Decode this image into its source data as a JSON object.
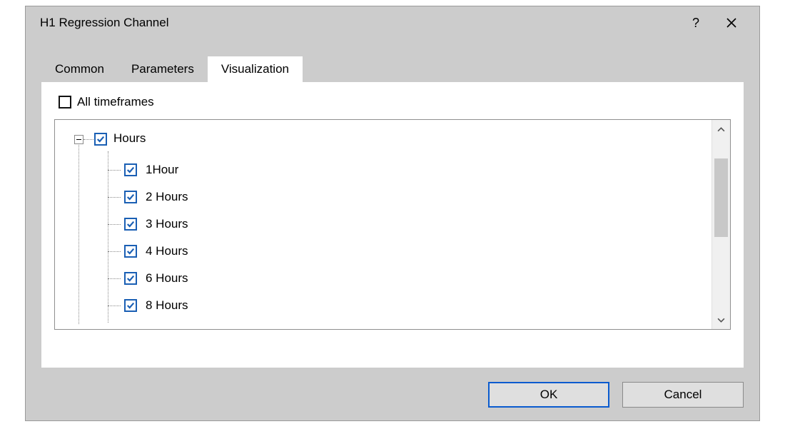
{
  "dialog": {
    "title": "H1 Regression Channel",
    "help_glyph": "?",
    "tabs": [
      {
        "label": "Common"
      },
      {
        "label": "Parameters"
      },
      {
        "label": "Visualization"
      }
    ],
    "active_tab": 2
  },
  "visualization": {
    "all_timeframes_label": "All timeframes",
    "all_timeframes_checked": false,
    "tree": {
      "root": {
        "label": "Hours",
        "checked": true,
        "expanded": true
      },
      "children": [
        {
          "label": "1Hour",
          "checked": true
        },
        {
          "label": "2 Hours",
          "checked": true
        },
        {
          "label": "3 Hours",
          "checked": true
        },
        {
          "label": "4 Hours",
          "checked": true
        },
        {
          "label": "6 Hours",
          "checked": true
        },
        {
          "label": "8 Hours",
          "checked": true
        }
      ]
    }
  },
  "footer": {
    "ok_label": "OK",
    "cancel_label": "Cancel"
  }
}
